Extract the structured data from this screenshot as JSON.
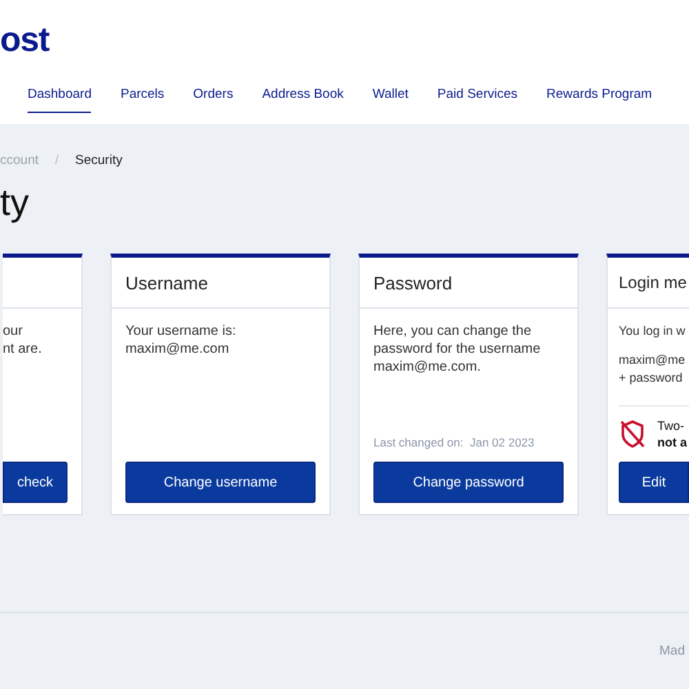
{
  "logo": "ost",
  "nav": [
    {
      "label": "Dashboard",
      "selected": true
    },
    {
      "label": "Parcels",
      "selected": false
    },
    {
      "label": "Orders",
      "selected": false
    },
    {
      "label": "Address Book",
      "selected": false
    },
    {
      "label": "Wallet",
      "selected": false
    },
    {
      "label": "Paid Services",
      "selected": false
    },
    {
      "label": "Rewards Program",
      "selected": false
    }
  ],
  "breadcrumb": [
    {
      "label": "ccount",
      "kind": "link"
    },
    {
      "label": "/",
      "kind": "separator"
    },
    {
      "label": "Security",
      "kind": "current"
    }
  ],
  "title": "ty",
  "cards": [
    {
      "paragraphs": [
        "our\nnt are."
      ],
      "button": "check"
    },
    {
      "title": "Username",
      "paragraphs": [
        "Your username is:\nmaxim@me.com"
      ],
      "button": "Change username"
    },
    {
      "title": "Password",
      "paragraphs": [
        "Here, you can change the\npassword for the username\nmaxim@me.com."
      ],
      "meta": {
        "label": "Last changed on:",
        "value": "Jan 02 2023"
      },
      "button": "Change password"
    },
    {
      "title": "Login me",
      "paragraphs": [
        "You log in w",
        "maxim@me\n+ password"
      ],
      "two_factor": {
        "line1": "Two-",
        "line2": "not a",
        "enabled": false
      },
      "button": "Edit"
    }
  ],
  "footer": "Mad"
}
